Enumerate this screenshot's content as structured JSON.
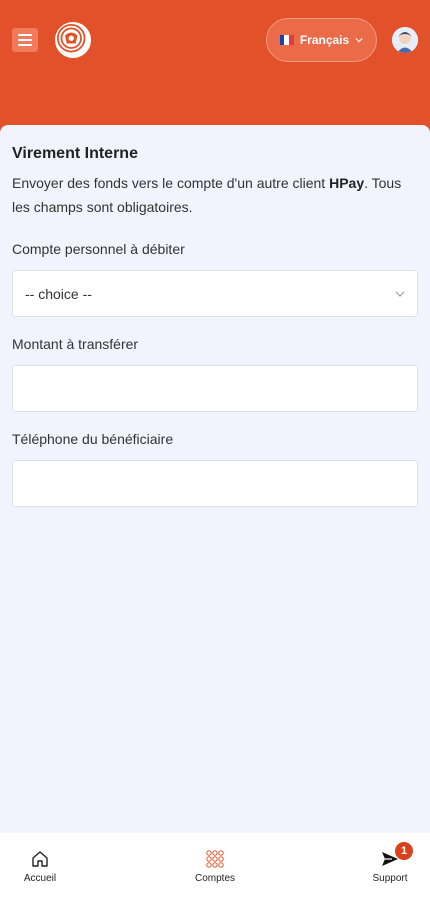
{
  "header": {
    "language_label": "Français",
    "brand_color": "#e2512a"
  },
  "form": {
    "title": "Virement Interne",
    "description_before": "Envoyer des fonds vers le compte d'un autre client ",
    "description_brand": "HPay",
    "description_after": ". Tous les champs sont obligatoires.",
    "account_label": "Compte personnel à débiter",
    "account_value": "-- choice --",
    "amount_label": "Montant à transférer",
    "amount_value": "",
    "phone_label": "Téléphone du bénéficiaire",
    "phone_value": ""
  },
  "bottom_nav": {
    "items": [
      {
        "label": "Accueil",
        "icon": "home-icon"
      },
      {
        "label": "Comptes",
        "icon": "grid-icon"
      },
      {
        "label": "Support",
        "icon": "send-icon",
        "badge": "1"
      }
    ]
  }
}
